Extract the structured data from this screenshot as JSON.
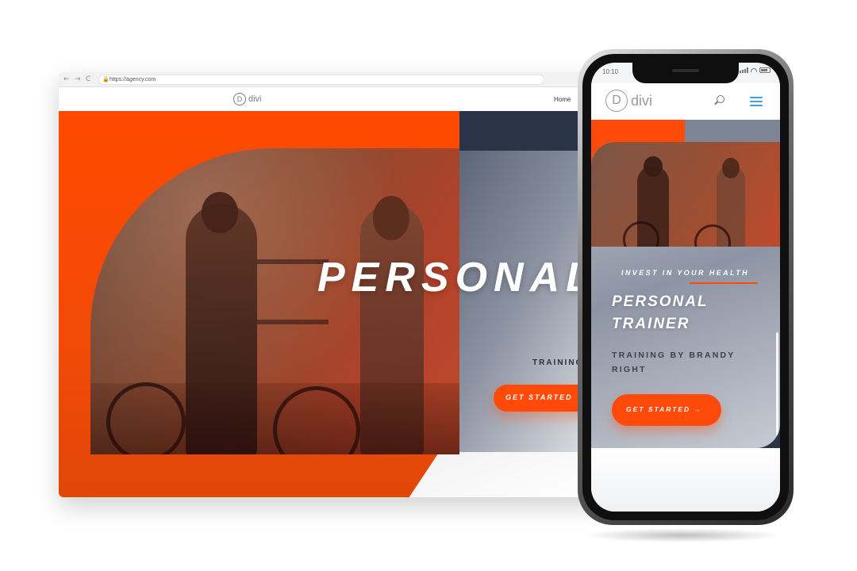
{
  "browser": {
    "url": "https://agency.com",
    "nav_back": "←",
    "nav_forward": "→",
    "nav_reload": "C"
  },
  "desktop": {
    "logo_mark": "D",
    "logo_text": "divi",
    "nav_home": "Home",
    "hero_title": "PERSONAL T",
    "hero_subtitle": "TRAINING",
    "cta_label": "GET STARTED"
  },
  "mobile": {
    "status_time": "10:10",
    "logo_mark": "D",
    "logo_text": "divi",
    "kicker": "INVEST IN YOUR HEALTH",
    "title": "PERSONAL\nTRAINER",
    "subtitle": "TRAINING BY BRANDY RIGHT",
    "cta_label": "GET STARTED →"
  },
  "colors": {
    "accent_orange": "#ff4a0a",
    "navy": "#2a3347",
    "menu_blue": "#3aa0e6"
  }
}
